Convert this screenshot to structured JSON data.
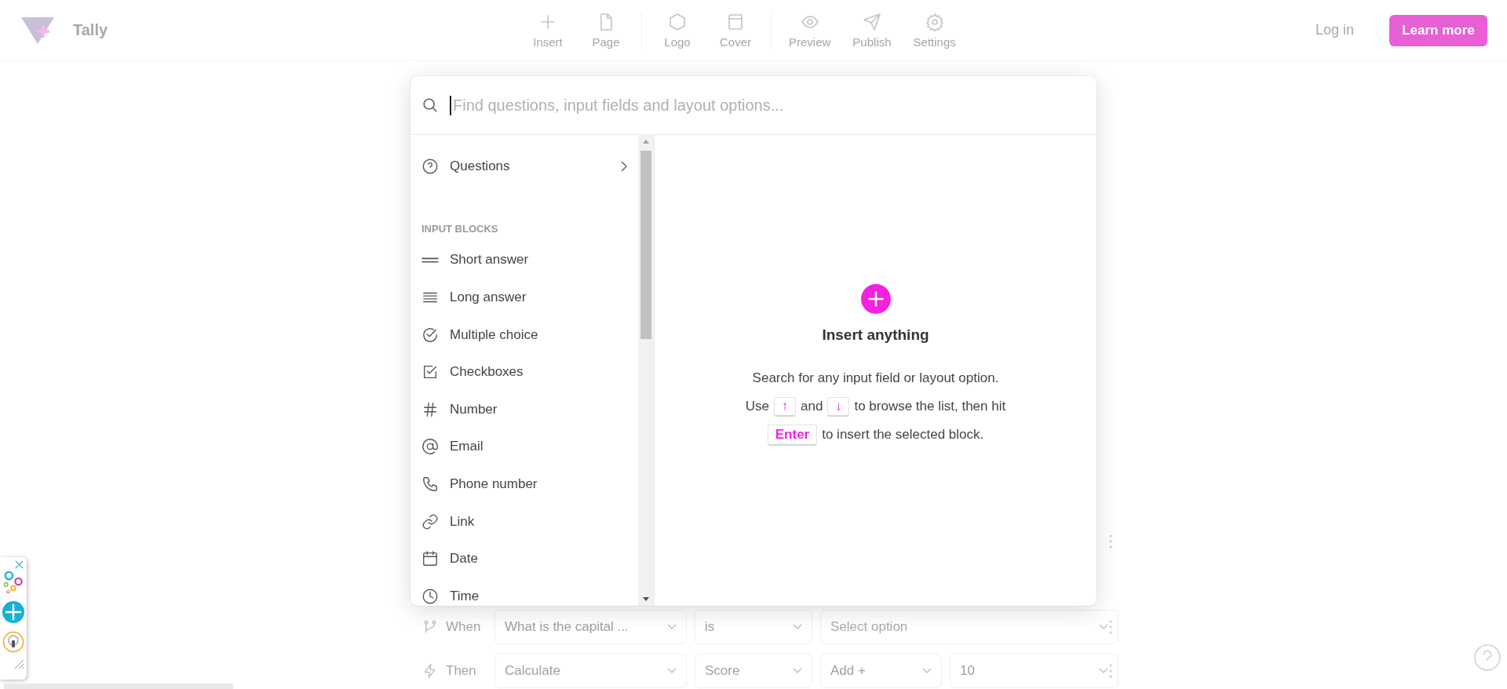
{
  "header": {
    "logo_text": "Tally",
    "toolbar": [
      {
        "label": "Insert"
      },
      {
        "label": "Page"
      },
      {
        "label": "Logo"
      },
      {
        "label": "Cover"
      },
      {
        "label": "Preview"
      },
      {
        "label": "Publish"
      },
      {
        "label": "Settings"
      }
    ],
    "login": "Log in",
    "cta": "Learn more"
  },
  "insert_dialog": {
    "search": {
      "placeholder": "Find questions, input fields and layout options..."
    },
    "top_items": [
      {
        "label": "Questions"
      }
    ],
    "group_heading": "INPUT BLOCKS",
    "items": [
      {
        "label": "Short answer"
      },
      {
        "label": "Long answer"
      },
      {
        "label": "Multiple choice"
      },
      {
        "label": "Checkboxes"
      },
      {
        "label": "Number"
      },
      {
        "label": "Email"
      },
      {
        "label": "Phone number"
      },
      {
        "label": "Link"
      },
      {
        "label": "Date"
      },
      {
        "label": "Time"
      }
    ],
    "empty_state": {
      "title": "Insert anything",
      "lines": [
        [
          {
            "kind": "text",
            "text": "Search for any input field or layout option."
          }
        ],
        [
          {
            "kind": "text",
            "text": "Use"
          },
          {
            "kind": "key",
            "text": "↑"
          },
          {
            "kind": "text",
            "text": "and"
          },
          {
            "kind": "key",
            "text": "↓"
          },
          {
            "kind": "text",
            "text": "to browse the list, then hit"
          }
        ],
        [
          {
            "kind": "key",
            "text": "Enter"
          },
          {
            "kind": "text",
            "text": "to insert the selected block."
          }
        ]
      ]
    }
  },
  "logic_rows": [
    {
      "label": "When",
      "fields": [
        {
          "value": "What is the capital ..."
        },
        {
          "value": "is"
        },
        {
          "placeholder": "Select option"
        }
      ]
    },
    {
      "label": "Then",
      "fields": [
        {
          "value": "Calculate"
        },
        {
          "value": "Score"
        },
        {
          "value": "Add +"
        },
        {
          "value": "10"
        }
      ]
    }
  ]
}
